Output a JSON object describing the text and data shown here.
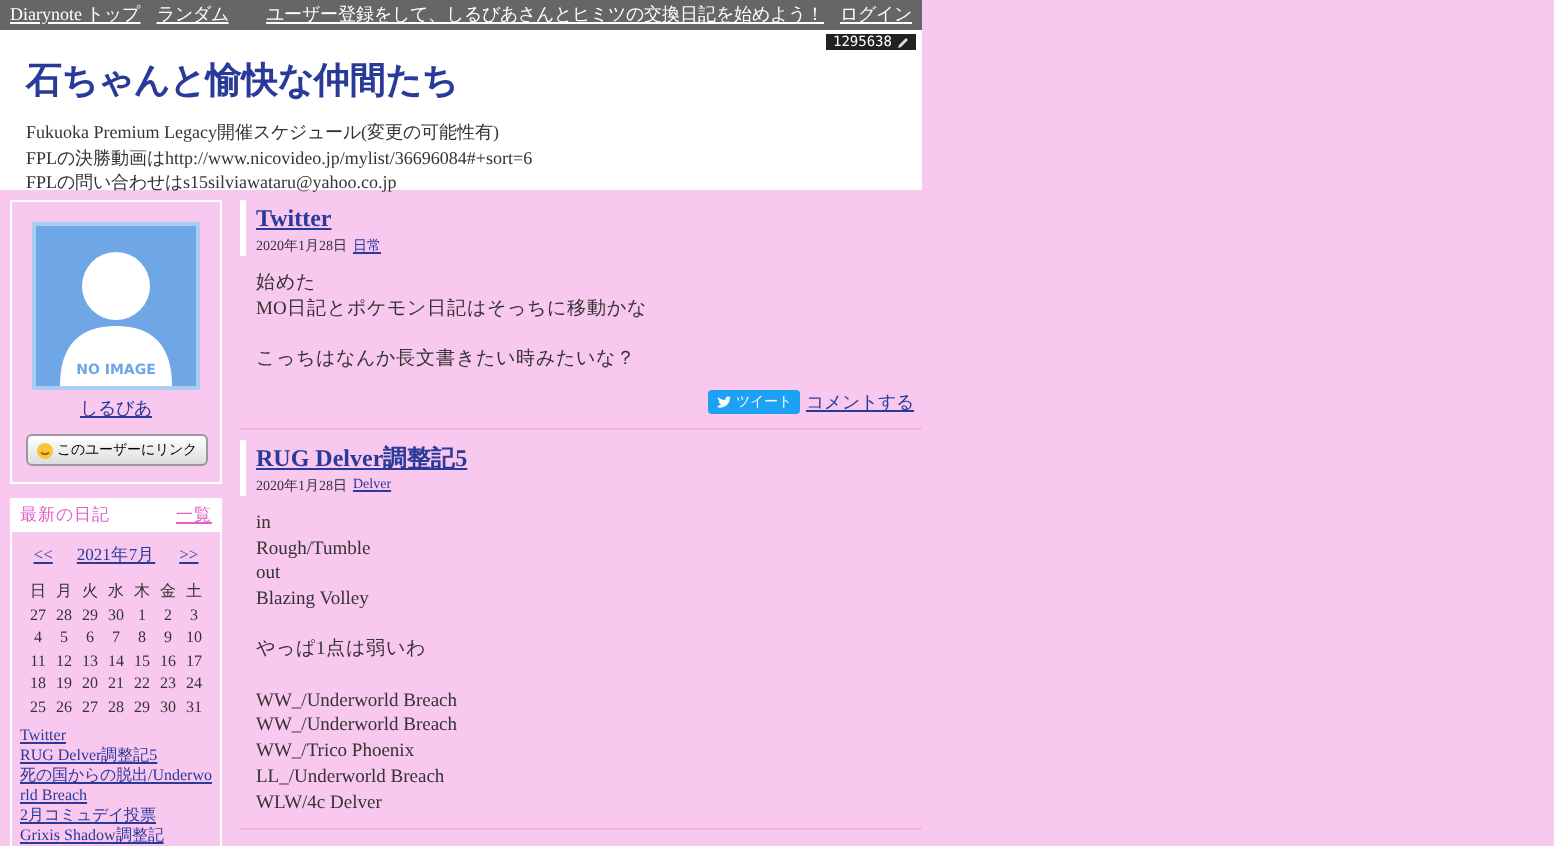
{
  "topbar": {
    "left_links": [
      "Diarynote トップ",
      "ランダム"
    ],
    "right_links": [
      "ユーザー登録をして、しるびあさんとヒミツの交換日記を始めよう！",
      "ログイン"
    ]
  },
  "header": {
    "counter": "1295638",
    "title": "石ちゃんと愉快な仲間たち",
    "description": [
      "Fukuoka Premium Legacy開催スケジュール(変更の可能性有)",
      "FPLの決勝動画はhttp://www.nicovideo.jp/mylist/36696084#+sort=6",
      "FPLの問い合わせはs15silviawataru@yahoo.co.jp"
    ]
  },
  "profile": {
    "image_label": "NO IMAGE",
    "username": "しるびあ",
    "link_button": "このユーザーにリンク"
  },
  "recent": {
    "title": "最新の日記",
    "more": "一覧",
    "calendar": {
      "prev": "<<",
      "month": "2021年7月",
      "next": ">>",
      "weekdays": [
        "日",
        "月",
        "火",
        "水",
        "木",
        "金",
        "土"
      ],
      "weeks": [
        [
          "27",
          "28",
          "29",
          "30",
          "1",
          "2",
          "3"
        ],
        [
          "4",
          "5",
          "6",
          "7",
          "8",
          "9",
          "10"
        ],
        [
          "11",
          "12",
          "13",
          "14",
          "15",
          "16",
          "17"
        ],
        [
          "18",
          "19",
          "20",
          "21",
          "22",
          "23",
          "24"
        ],
        [
          "25",
          "26",
          "27",
          "28",
          "29",
          "30",
          "31"
        ]
      ]
    },
    "entries": [
      "Twitter",
      "RUG Delver調整記5",
      "死の国からの脱出/Underworld Breach",
      "2月コミュデイ投票",
      "Grixis Shadow調整記"
    ]
  },
  "posts": [
    {
      "title": "Twitter",
      "date": "2020年1月28日",
      "category": "日常",
      "body": [
        [
          "始めた",
          "MO日記とポケモン日記はそっちに移動かな"
        ],
        [
          "こっちはなんか長文書きたい時みたいな？"
        ]
      ],
      "tweet": "ツイート",
      "comment": "コメントする"
    },
    {
      "title": "RUG Delver調整記5",
      "date": "2020年1月28日",
      "category": "Delver",
      "body": [
        [
          "in",
          "Rough/Tumble",
          "out",
          "Blazing Volley"
        ],
        [
          "やっぱ1点は弱いわ"
        ],
        [
          "WW_/Underworld Breach",
          "WW_/Underworld Breach",
          "WW_/Trico Phoenix",
          "LL_/Underworld Breach",
          "WLW/4c Delver"
        ]
      ]
    }
  ]
}
